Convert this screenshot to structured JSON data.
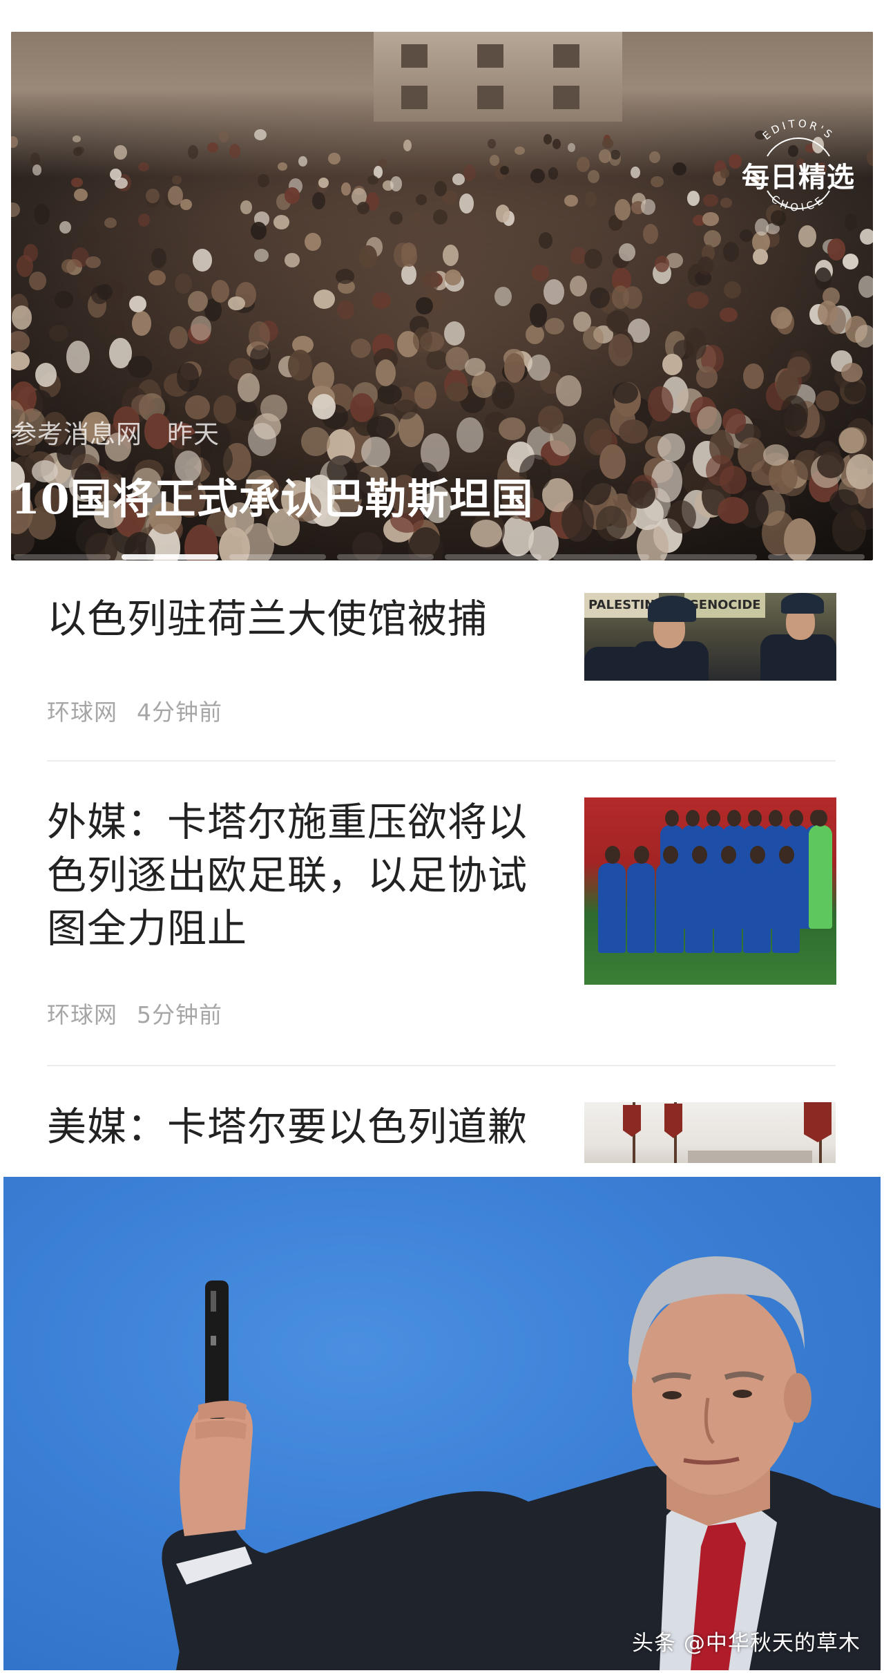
{
  "hero": {
    "source": "参考消息网",
    "time": "昨天",
    "title": "10国将正式承认巴勒斯坦国",
    "badge": {
      "title": "每日精选",
      "ring_top": "EDITOR'S",
      "ring_bottom": "CHOICE"
    },
    "carousel": {
      "count": 8,
      "active_index": 1
    }
  },
  "news": [
    {
      "title": "以色列驻荷兰大使馆被捕",
      "source": "环球网",
      "time": "4分钟前",
      "thumb_icon": "police-photo",
      "thumb_sign_left": "PALESTIN",
      "thumb_sign_right": "GENOCIDE"
    },
    {
      "title": "外媒：卡塔尔施重压欲将以色列逐出欧足联，以足协试图全力阻止",
      "source": "环球网",
      "time": "5分钟前",
      "thumb_icon": "football-team-photo"
    },
    {
      "title": "美媒：卡塔尔要以色列道歉",
      "thumb_icon": "flags-photo"
    }
  ],
  "photo": {
    "icon": "politician-raising-pen-photo",
    "watermark": "头条 @中华秋天的草木"
  },
  "colors": {
    "title_text": "#222222",
    "meta_text": "#a6a6a6",
    "divider": "#ececec",
    "photo_bg": "#3b80d6"
  }
}
